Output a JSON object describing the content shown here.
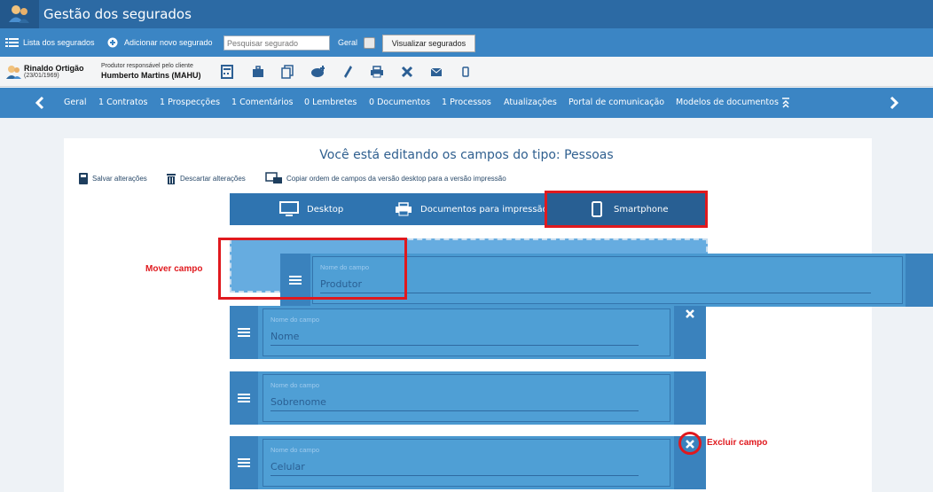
{
  "app": {
    "title": "Gestão dos segurados"
  },
  "toolbar": {
    "list_label": "Lista dos segurados",
    "add_label": "Adicionar novo segurado",
    "search_placeholder": "Pesquisar segurado",
    "geral_label": "Geral",
    "visualizar_label": "Visualizar segurados"
  },
  "client": {
    "name": "Rinaldo Ortigão",
    "dob": "(23/01/1969)",
    "resp_label": "Produtor responsável pelo cliente",
    "resp_name": "Humberto Martins (MAHU)"
  },
  "nav": {
    "tabs": [
      "Geral",
      "1 Contratos",
      "1 Prospecções",
      "1 Comentários",
      "0 Lembretes",
      "0 Documentos",
      "1 Processos",
      "Atualizações",
      "Portal de comunicação",
      "Modelos de documentos"
    ]
  },
  "editor": {
    "title": "Você está editando os campos do tipo: Pessoas",
    "save_label": "Salvar alterações",
    "discard_label": "Descartar alterações",
    "copy_label": "Copiar ordem de campos da versão desktop para a versão impressão",
    "tabs": [
      "Desktop",
      "Documentos para impressão",
      "Smartphone"
    ]
  },
  "fields": [
    {
      "label": "Nome do campo",
      "value": "Produtor"
    },
    {
      "label": "Nome do campo",
      "value": "Nome"
    },
    {
      "label": "Nome do campo",
      "value": "Sobrenome"
    },
    {
      "label": "Nome do campo",
      "value": "Celular"
    }
  ],
  "annotations": {
    "move": "Mover campo",
    "delete": "Excluir campo"
  },
  "colors": {
    "accent": "#3b85c4",
    "dark": "#23588c",
    "highlight": "#e0191e"
  }
}
